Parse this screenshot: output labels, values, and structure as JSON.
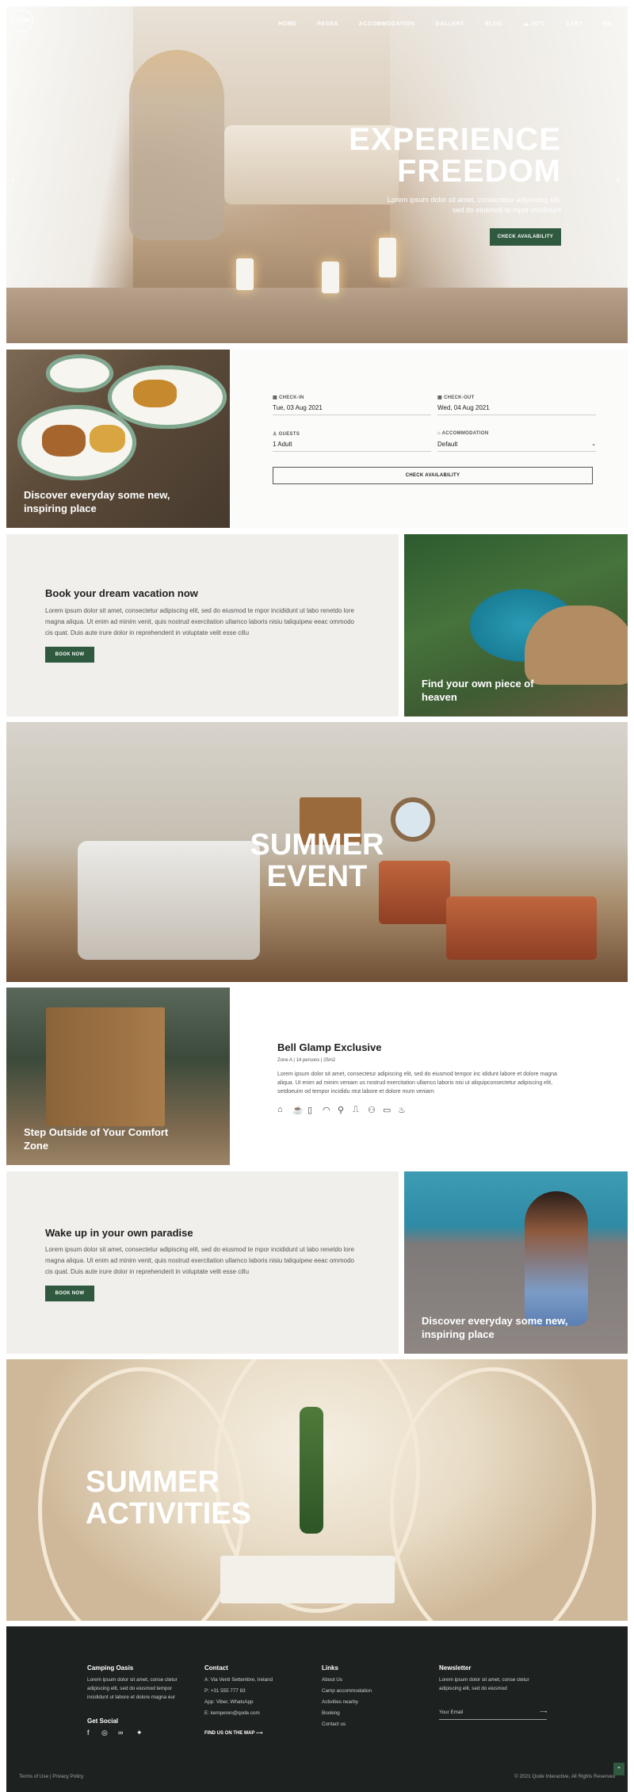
{
  "nav": {
    "logo_text": "CAMP",
    "items": [
      "HOME",
      "PAGES",
      "ACCOMMODATION",
      "GALLERY",
      "BLOG"
    ],
    "weather": "30°C",
    "cart": "CART",
    "lang": "EN"
  },
  "hero": {
    "title_line1": "EXPERIENCE",
    "title_line2": "FREEDOM",
    "subtitle": "Lorem ipsum dolor sit amet, consectetur adipiscing elit, sed do eiusmod te mpor incididunt",
    "button": "CHECK AVAILABILITY"
  },
  "food_block": {
    "caption": "Discover everyday some new, inspiring place"
  },
  "booking": {
    "checkin_label": "CHECK-IN",
    "checkin_value": "Tue, 03 Aug 2021",
    "checkout_label": "CHECK-OUT",
    "checkout_value": "Wed, 04 Aug 2021",
    "guests_label": "GUESTS",
    "guests_value": "1 Adult",
    "accommodation_label": "ACCOMMODATION",
    "accommodation_value": "Default",
    "button": "CHECK AVAILABILITY"
  },
  "dream": {
    "title": "Book your dream vacation now",
    "text": "Lorem ipsum dolor sit amet, consectetur adipiscing elit, sed do eiusmod te mpor incididunt ut labo renetdo lore magna aliqua. Ut enim ad minim venit, quis nostrud exercitation ullamco laboris nisiu taliquipew eeac ommodo cis quat. Duis aute irure dolor in reprehenderit in voluptate velit esse cillu",
    "button": "BOOK NOW"
  },
  "pool_block": {
    "caption": "Find your own piece of heaven"
  },
  "summer_event": {
    "line1": "SUMMER",
    "line2": "EVENT"
  },
  "cabin_block": {
    "caption": "Step Outside of Your Comfort Zone"
  },
  "exclusive": {
    "title": "Bell Glamp Exclusive",
    "meta": "Zone A | 14 persons | 25m2",
    "text": "Lorem ipsum dolor sit amet, consectetur adipiscing elit, sed do eiusmod tempor inc ididunt labore et dolore magna aliqua. Ut enim ad minim veniam us nostrud exercitation ullamco laboris nisi ut aliquipconsectetur adipiscing elit, setdoeuim od tempor incididu ntut labore et dolore mum veniam",
    "amenities": [
      "bed-icon",
      "coffee-icon",
      "mirror-icon",
      "wifi-icon",
      "hanger-icon",
      "parking-icon",
      "bike-icon",
      "tv-icon",
      "bath-icon"
    ]
  },
  "paradise": {
    "title": "Wake up in your own paradise",
    "text": "Lorem ipsum dolor sit amet, consectetur adipiscing elit, sed do eiusmod te mpor incididunt ut labo renetdo lore magna aliqua. Ut enim ad minim venit, quis nostrud exercitation ullamco laboris nisiu taliquipew eeac ommodo cis quat. Duis aute irure dolor in reprehenderit in voluptate velit esse cillu",
    "button": "BOOK NOW"
  },
  "pool2_block": {
    "caption": "Discover everyday some new, inspiring place"
  },
  "summer_activities": {
    "line1": "SUMMER",
    "line2": "ACTIVITIES"
  },
  "footer": {
    "brand_title": "Camping Oasis",
    "brand_text": "Lorem ipsum dolor sit amet, conse ctetur adipiscing elit, sed do eiusmod tempor incididunt ut labore et dolore magna eur",
    "social_title": "Get Social",
    "contact_title": "Contact",
    "contact_lines": [
      "A: Via Venti Settembre, Ireland",
      "P: +31 555 777 83",
      "App: Viber, WhatsApp",
      "E: kemperen@qode.com"
    ],
    "map_link": "FIND US ON THE MAP",
    "links_title": "Links",
    "links": [
      "About Us",
      "Camp accommodation",
      "Activities nearby",
      "Booking",
      "Contact us"
    ],
    "newsletter_title": "Newsletter",
    "newsletter_text": "Lorem ipsum dolor sit amet, conse ctetur adipiscing elit, sed do eiusmod",
    "email_placeholder": "Your Email",
    "bottom_left": "Terms of Use | Privacy Policy",
    "bottom_right": "© 2021 Qode Interactive, All Rights Reserved"
  }
}
